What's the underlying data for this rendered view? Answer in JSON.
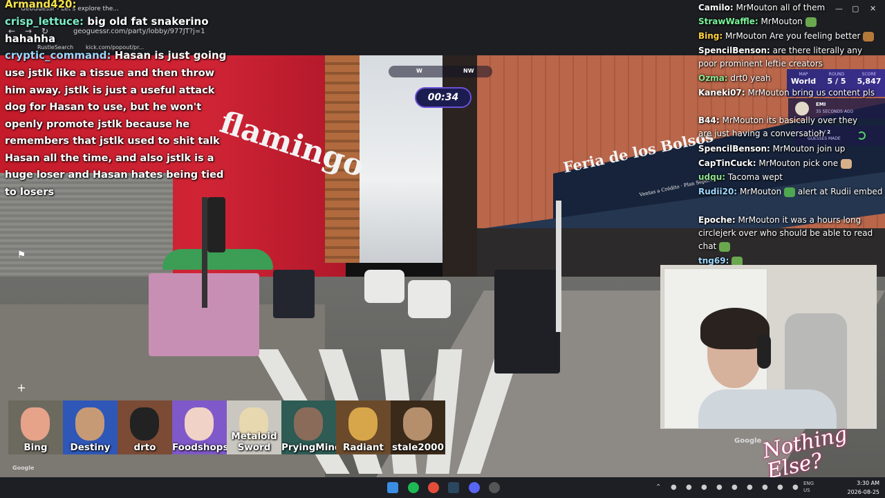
{
  "browser": {
    "tab_title": "GeoGuessr - Let's explore the...",
    "url": "geoguessr.com/party/lobby/977JT?j=1",
    "bookmarks": [
      "RustleSearch",
      "kick.com/popout/pr..."
    ]
  },
  "overlay_chat": {
    "messages": [
      {
        "user": "Armand420:",
        "text": "",
        "user_color": "#f4e24a"
      },
      {
        "user": "crisp_lettuce:",
        "text": "big old fat snakerino",
        "user_color": "#7df0c8"
      },
      {
        "user": "",
        "text": "hahahha",
        "user_color": "#ffffff"
      },
      {
        "user": "cryptic_command:",
        "text": "Hasan is just going",
        "user_color": "#9dd7ff"
      }
    ],
    "long_message": "use jstlk like a tissue and then throw him away. jstlk is just a useful attack dog for Hasan to use, but he won't openly promote jstlk because he remembers that jstlk used to shit talk Hasan all the time, and also jstlk is a huge loser and Hasan hates being tied to losers"
  },
  "right_chat": {
    "messages": [
      {
        "user": "Camilo:",
        "text": "MrMouton all of them",
        "user_color": "#ffffff"
      },
      {
        "user": "StrawWaffle:",
        "text": "MrMouton",
        "user_color": "#7af59a"
      },
      {
        "user": "Bing:",
        "text": "MrMouton Are you feeling better",
        "user_color": "#ffd23a"
      },
      {
        "user": "SpencilBenson:",
        "text": "are there literally any poor prominent leftie creators",
        "user_color": "#ffffff"
      },
      {
        "user": "Ozma:",
        "text": "drt0 yeah",
        "user_color": "#8fe38f"
      },
      {
        "user": "Kaneki07:",
        "text": "MrMouton bring us content pls",
        "user_color": "#ffffff"
      },
      {
        "user": "B44:",
        "text": "MrMouton its basically over they are just having a conversation",
        "user_color": "#ffffff"
      },
      {
        "user": "SpencilBenson:",
        "text": "MrMouton join up",
        "user_color": "#ffffff"
      },
      {
        "user": "CapTinCuck:",
        "text": "MrMouton pick one",
        "user_color": "#ffffff"
      },
      {
        "user": "udqu:",
        "text": "Tacoma wept",
        "user_color": "#8fe38f"
      },
      {
        "user": "Rudii20:",
        "text": "MrMouton",
        "text2": "alert at Rudii embed",
        "user_color": "#9dd7ff"
      },
      {
        "user": "Epoche:",
        "text": "MrMouton it was a hours long circlejerk over who should be able to read chat",
        "user_color": "#ffffff"
      },
      {
        "user": "tng69:",
        "text": "",
        "user_color": "#9dd7ff"
      }
    ]
  },
  "hud": {
    "compass": [
      "W",
      "NW"
    ],
    "timer": "00:34",
    "map_label": "MAP",
    "map_value": "World",
    "round_label": "ROUND",
    "round_value": "5 / 5",
    "score_label": "SCORE",
    "score_value": "5,847",
    "player_name": "EMI",
    "player_time": "35 SECONDS AGO",
    "guesses_count": "1 / 2",
    "guesses_label": "GUESSES MADE",
    "zoom_in": "+",
    "zoom_out": "−"
  },
  "signs": {
    "left": "flamingo",
    "right": "Feria de los Bolsos",
    "right_small": "Ventas a Crédito · Plan Separe"
  },
  "players": [
    {
      "name": "Bing",
      "color": "#e7a28a",
      "bg": "#6c6a5f"
    },
    {
      "name": "Destiny",
      "color": "#c79a76",
      "bg": "#2f57b8"
    },
    {
      "name": "drto",
      "color": "#222222",
      "bg": "#7b4b35"
    },
    {
      "name": "Foodshops",
      "color": "#f0d2c6",
      "bg": "#7f59c9"
    },
    {
      "name": "Metaloid Sword",
      "color": "#e8d8b0",
      "bg": "#c9c7c0"
    },
    {
      "name": "PryingMind",
      "color": "#8a6b5a",
      "bg": "#2e5b54"
    },
    {
      "name": "Radiant",
      "color": "#d8a64a",
      "bg": "#6a4a2b"
    },
    {
      "name": "stale2000",
      "color": "#b58f6c",
      "bg": "#3a2a1a"
    }
  ],
  "google_watermark": "Google",
  "brand_overlay": "Nothing Else?",
  "tray": {
    "lang": "ENG",
    "region": "US",
    "time": "3:30 AM",
    "date": "2026-08-25"
  }
}
